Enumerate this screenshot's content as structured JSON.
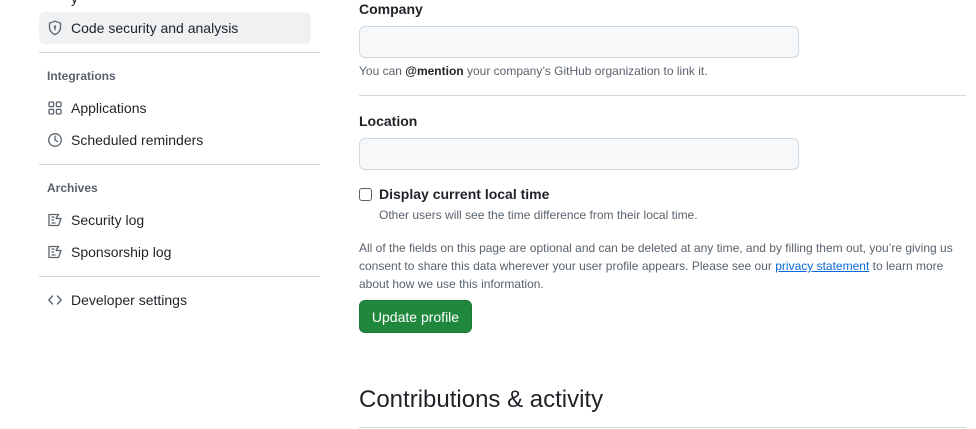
{
  "sidebar": {
    "partial_top": "y",
    "active_item": {
      "label": "Code security and analysis",
      "icon": "shield-icon"
    },
    "sections": [
      {
        "title": "Integrations",
        "items": [
          {
            "label": "Applications",
            "icon": "apps-icon"
          },
          {
            "label": "Scheduled reminders",
            "icon": "clock-icon"
          }
        ]
      },
      {
        "title": "Archives",
        "items": [
          {
            "label": "Security log",
            "icon": "log-icon"
          },
          {
            "label": "Sponsorship log",
            "icon": "log-icon"
          }
        ]
      }
    ],
    "developer_settings": {
      "label": "Developer settings",
      "icon": "code-icon"
    }
  },
  "main": {
    "company": {
      "label": "Company",
      "value": "",
      "note_prefix": "You can ",
      "note_mention": "@mention",
      "note_suffix": " your company’s GitHub organization to link it."
    },
    "location": {
      "label": "Location",
      "value": ""
    },
    "local_time": {
      "label": "Display current local time",
      "checked": false,
      "note": "Other users will see the time difference from their local time."
    },
    "legal": {
      "before_link": "All of the fields on this page are optional and can be deleted at any time, and by filling them out, you’re giving us consent to share this data wherever your user profile appears. Please see our ",
      "link": "privacy statement",
      "after_link": " to learn more about how we use this information."
    },
    "update_button": "Update profile",
    "section_heading": "Contributions & activity"
  },
  "colors": {
    "primary_button": "#1f883d",
    "link": "#0969da",
    "active_nav_bg": "#eff1f3",
    "muted_text": "#59636e",
    "border": "#d1d9e0"
  }
}
